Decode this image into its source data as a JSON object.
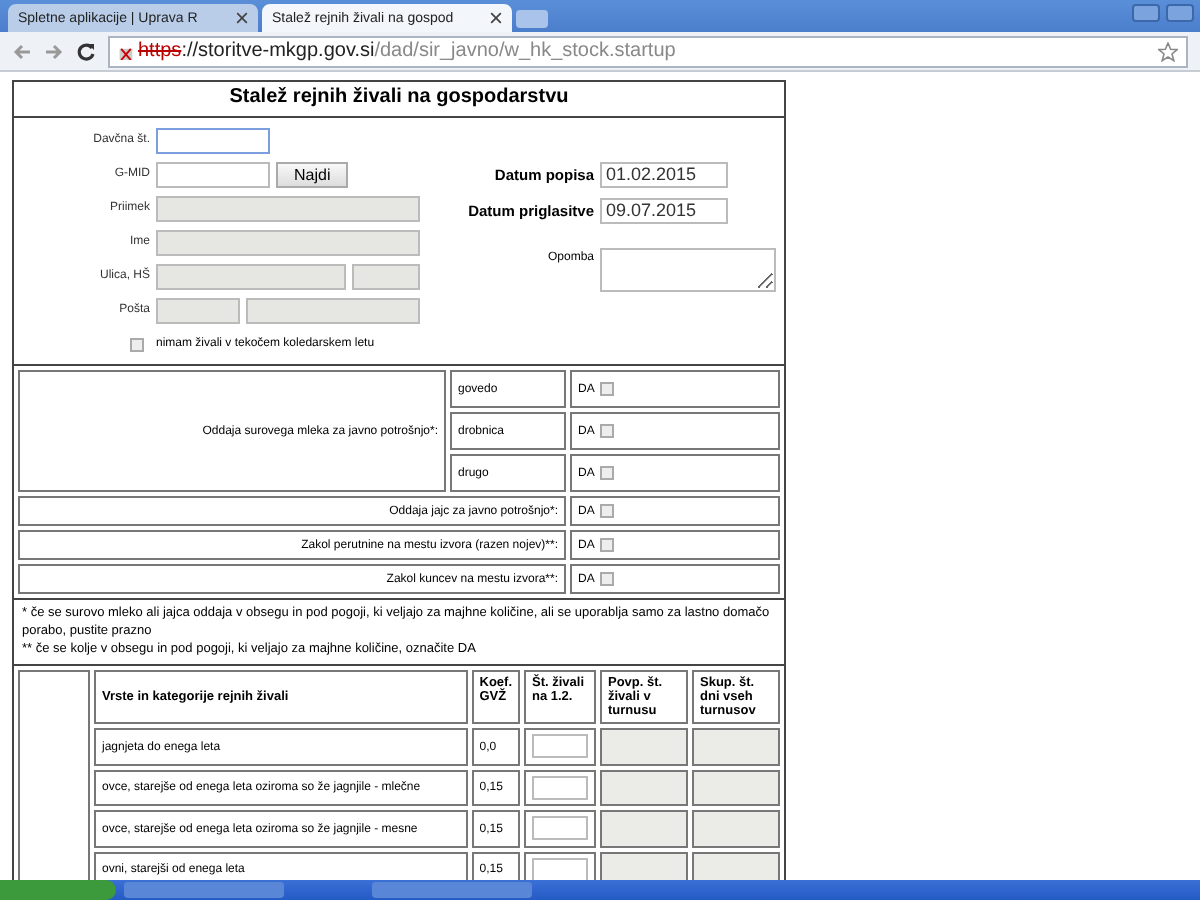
{
  "browser": {
    "tabs": [
      {
        "label": "Spletne aplikacije | Uprava R",
        "selected": false
      },
      {
        "label": "Stalež rejnih živali na gospod",
        "selected": true
      }
    ],
    "url": {
      "scheme": "https",
      "rest": "://storitve-mkgp.gov.si",
      "path": "/dad/sir_javno/w_hk_stock.startup"
    }
  },
  "form": {
    "title": "Stalež rejnih živali na gospodarstvu",
    "tax_number": {
      "label": "Davčna št."
    },
    "gmid": {
      "label": "G-MID",
      "button": "Najdi"
    },
    "surname": {
      "label": "Priimek",
      "disabled": true
    },
    "name": {
      "label": "Ime",
      "disabled": true
    },
    "street": {
      "label": "Ulica, HŠ",
      "disabled": true
    },
    "post": {
      "label": "Pošta",
      "disabled": true
    },
    "no_animals": {
      "label": "nimam živali v tekočem koledarskem letu",
      "checked": false
    },
    "inventory_date": {
      "label": "Datum popisa",
      "value": "01.02.2015"
    },
    "report_date": {
      "label": "Datum priglasitve",
      "value": "09.07.2015"
    },
    "note": {
      "label": "Opomba"
    }
  },
  "declarations": {
    "milk": {
      "label": "Oddaja surovega mleka za javno potrošnjo*:",
      "items": [
        {
          "label": "govedo",
          "option": "DA",
          "checked": false
        },
        {
          "label": "drobnica",
          "option": "DA",
          "checked": false
        },
        {
          "label": "drugo",
          "option": "DA",
          "checked": false
        }
      ]
    },
    "others": [
      {
        "label": "Oddaja jajc za javno potrošnjo*:",
        "option": "DA",
        "checked": false
      },
      {
        "label": "Zakol perutnine na mestu izvora (razen nojev)**:",
        "option": "DA",
        "checked": false
      },
      {
        "label": "Zakol kuncev na mestu izvora**:",
        "option": "DA",
        "checked": false
      }
    ],
    "notes": [
      "* če se surovo mleko ali jajca oddaja v obsegu in pod pogoji, ki veljajo za majhne količine, ali se uporablja samo za lastno domačo porabo, pustite prazno",
      "** če se kolje v obsegu in pod pogoji, ki veljajo za majhne količine, označite DA"
    ]
  },
  "animals": {
    "columns": [
      "Vrste in kategorije rejnih živali",
      "Koef. GVŽ",
      "Št. živali na 1.2.",
      "Povp. št. živali v turnusu",
      "Skup. št. dni vseh turnusov"
    ],
    "rows": [
      {
        "category": "jagnjeta do enega leta",
        "coefficient": "0,0"
      },
      {
        "category": "ovce, starejše od enega leta oziroma so že jagnjile - mlečne",
        "coefficient": "0,15"
      },
      {
        "category": "ovce, starejše od enega leta oziroma so že jagnjile - mesne",
        "coefficient": "0,15"
      },
      {
        "category": "ovni, starejši od enega leta",
        "coefficient": "0,15"
      }
    ]
  }
}
